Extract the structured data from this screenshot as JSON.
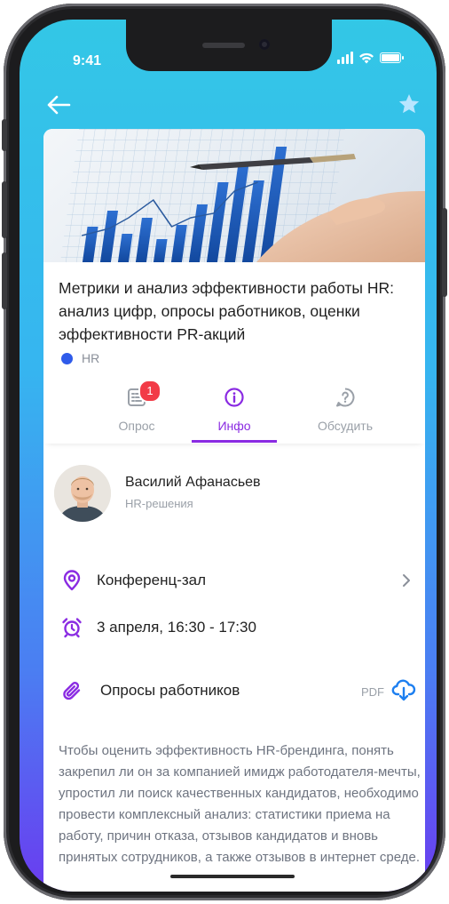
{
  "status_bar": {
    "time": "9:41"
  },
  "icons": {
    "back": "arrow-left-icon",
    "favorite": "star-icon",
    "survey": "list-icon",
    "info": "info-icon",
    "discuss": "question-icon",
    "location": "location-pin-icon",
    "time": "alarm-clock-icon",
    "attachment": "paperclip-icon",
    "download": "cloud-download-icon",
    "chevron": "chevron-right-icon"
  },
  "colors": {
    "accent": "#8a2be2",
    "tag_dot": "#2f5bea",
    "badge": "#f23b47",
    "star": "#b8e6ff"
  },
  "event": {
    "title": "Метрики и анализ эффективности работы HR: анализ цифр, опросы работников, оценки эффективности PR-акций",
    "tag": "HR"
  },
  "tabs": [
    {
      "label": "Опрос",
      "badge": "1",
      "active": false
    },
    {
      "label": "Инфо",
      "active": true
    },
    {
      "label": "Обсудить",
      "active": false
    }
  ],
  "speaker": {
    "name": "Василий Афанасьев",
    "role": "HR-решения"
  },
  "details": {
    "location": "Конференц-зал",
    "datetime": "3 апреля, 16:30 - 17:30"
  },
  "attachment": {
    "name": "Опросы работников",
    "format": "PDF"
  },
  "description": "Чтобы оценить эффективность HR-брендинга, понять закрепил ли он за компанией имидж работодателя-мечты, упростил ли поиск качественных кандидатов, необходимо провести комплексный анализ: статистики приема на работу, причин отказа, отзывов кандидатов и вновь принятых сотрудников, а также отзывов в интернет среде."
}
